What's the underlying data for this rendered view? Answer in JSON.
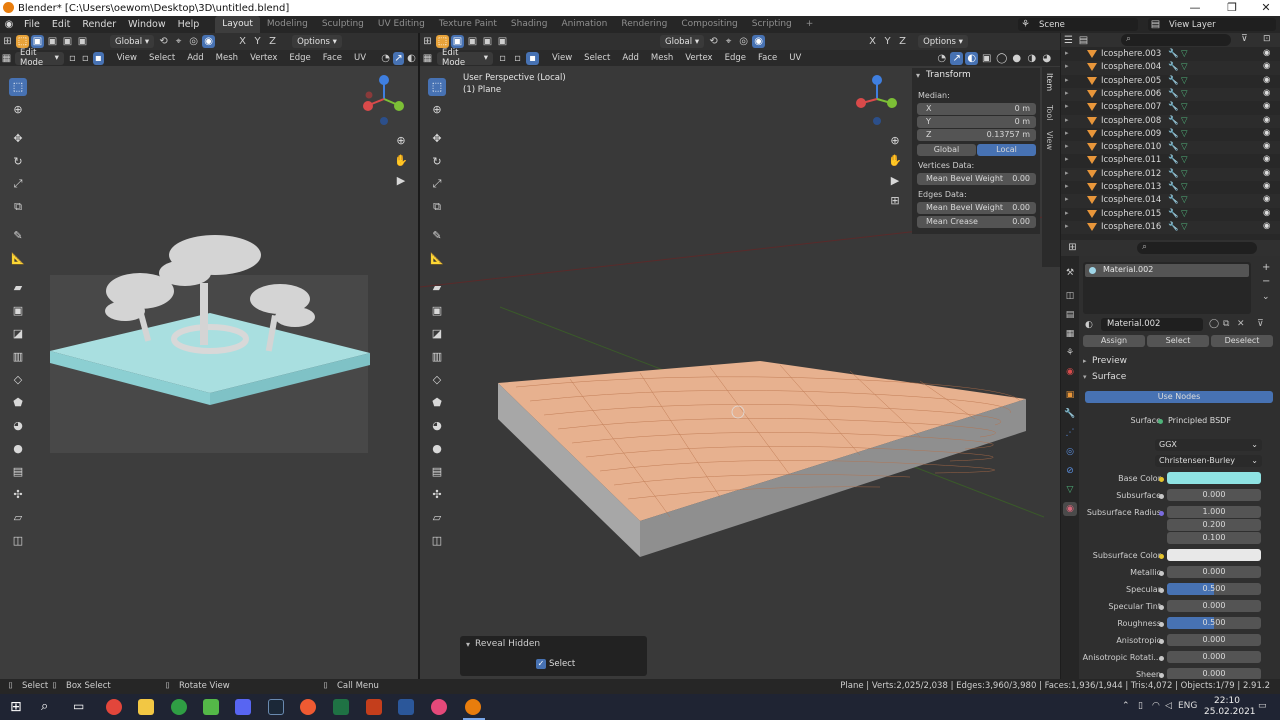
{
  "window": {
    "title": "Blender* [C:\\Users\\oewom\\Desktop\\3D\\untitled.blend]",
    "min": "—",
    "max": "❐",
    "close": "✕"
  },
  "menu": [
    "File",
    "Edit",
    "Render",
    "Window",
    "Help"
  ],
  "workspaces": [
    "Layout",
    "Modeling",
    "Sculpting",
    "UV Editing",
    "Texture Paint",
    "Shading",
    "Animation",
    "Rendering",
    "Compositing",
    "Scripting"
  ],
  "add_workspace": "+",
  "scene": {
    "name": "Scene",
    "view_layer": "View Layer"
  },
  "left_view": {
    "transform": "Global",
    "options": "Options",
    "mode": "Edit Mode",
    "header_menu": [
      "View",
      "Select",
      "Add",
      "Mesh",
      "Vertex",
      "Edge",
      "Face",
      "UV"
    ]
  },
  "main_view": {
    "transform": "Global",
    "options": "Options",
    "mode": "Edit Mode",
    "header_menu": [
      "View",
      "Select",
      "Add",
      "Mesh",
      "Vertex",
      "Edge",
      "Face",
      "UV"
    ],
    "overlay_title": "User Perspective (Local)",
    "overlay_object": "(1) Plane",
    "side_tabs": [
      "Item",
      "Tool",
      "View"
    ]
  },
  "npanel": {
    "title": "Transform",
    "median_label": "Median:",
    "x": {
      "label": "X",
      "value": "0 m"
    },
    "y": {
      "label": "Y",
      "value": "0 m"
    },
    "z": {
      "label": "Z",
      "value": "0.13757 m"
    },
    "global": "Global",
    "local": "Local",
    "vertices_data": "Vertices Data:",
    "vert_bevel": {
      "label": "Mean Bevel Weight",
      "value": "0.00"
    },
    "edges_data": "Edges Data:",
    "edge_bevel": {
      "label": "Mean Bevel Weight",
      "value": "0.00"
    },
    "crease": {
      "label": "Mean Crease",
      "value": "0.00"
    }
  },
  "outliner": {
    "items": [
      "Icosphere.003",
      "Icosphere.004",
      "Icosphere.005",
      "Icosphere.006",
      "Icosphere.007",
      "Icosphere.008",
      "Icosphere.009",
      "Icosphere.010",
      "Icosphere.011",
      "Icosphere.012",
      "Icosphere.013",
      "Icosphere.014",
      "Icosphere.015",
      "Icosphere.016"
    ]
  },
  "properties": {
    "slot": "Material.002",
    "material": "Material.002",
    "assign": "Assign",
    "select": "Select",
    "deselect": "Deselect",
    "preview": "Preview",
    "surface_section": "Surface",
    "use_nodes": "Use Nodes",
    "surface_label": "Surface",
    "surface_value": "Principled BSDF",
    "distribution": "GGX",
    "subsurface_method": "Christensen-Burley",
    "base_color_label": "Base Color",
    "base_color": "#8fe3e3",
    "subsurface": {
      "label": "Subsurface",
      "value": "0.000"
    },
    "subsurface_radius": {
      "label": "Subsurface Radius",
      "values": [
        "1.000",
        "0.200",
        "0.100"
      ]
    },
    "subsurface_color_label": "Subsurface Color",
    "subsurface_color": "#e8e8e8",
    "metallic": {
      "label": "Metallic",
      "value": "0.000"
    },
    "specular": {
      "label": "Specular",
      "value": "0.500",
      "fill": 0.5
    },
    "specular_tint": {
      "label": "Specular Tint",
      "value": "0.000"
    },
    "roughness": {
      "label": "Roughness",
      "value": "0.500",
      "fill": 0.5
    },
    "anisotropic": {
      "label": "Anisotropic",
      "value": "0.000"
    },
    "anisotropic_rotation": {
      "label": "Anisotropic Rotati...",
      "value": "0.000"
    },
    "sheen": {
      "label": "Sheen",
      "value": "0.000"
    }
  },
  "reveal_hidden": {
    "title": "Reveal Hidden",
    "select_label": "Select"
  },
  "status": {
    "select": "Select",
    "box_select": "Box Select",
    "rotate_view": "Rotate View",
    "call_menu": "Call Menu",
    "stats": "Plane | Verts:2,025/2,038 | Edges:3,960/3,980 | Faces:1,936/1,944 | Tris:4,072 | Objects:1/79 | 2.91.2"
  },
  "taskbar": {
    "lang": "ENG",
    "time": "22:10",
    "date": "25.02.2021"
  },
  "colors": {
    "accent": "#4772b3",
    "mesh": "#e8b48f",
    "water": "#8fd6d9",
    "object_icon": "#e8963a",
    "mesh_icon": "#4fb37a"
  }
}
